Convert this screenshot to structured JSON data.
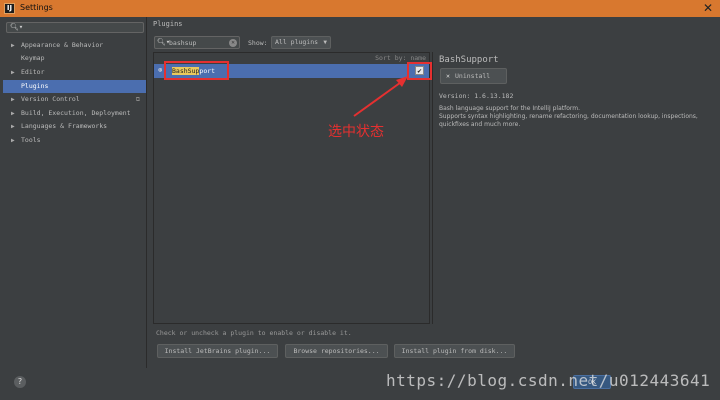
{
  "window": {
    "title": "Settings",
    "close_glyph": "✕"
  },
  "sidebar": {
    "search_placeholder": "",
    "items": [
      {
        "label": "Appearance & Behavior",
        "expandable": true
      },
      {
        "label": "Keymap",
        "expandable": false
      },
      {
        "label": "Editor",
        "expandable": true
      },
      {
        "label": "Plugins",
        "expandable": false,
        "selected": true
      },
      {
        "label": "Version Control",
        "expandable": true
      },
      {
        "label": "Build, Execution, Deployment",
        "expandable": true
      },
      {
        "label": "Languages & Frameworks",
        "expandable": true
      },
      {
        "label": "Tools",
        "expandable": true
      }
    ]
  },
  "plugins": {
    "header": "Plugins",
    "search_value": "bashsup",
    "show_label": "Show:",
    "show_value": "All plugins",
    "sort_by": "Sort by: name",
    "list": [
      {
        "name_highlight": "BashSup",
        "name_rest": "port",
        "checked": true
      }
    ],
    "hint": "Check or uncheck a plugin to enable or disable it.",
    "buttons": {
      "install_jetbrains": "Install JetBrains plugin...",
      "browse": "Browse repositories...",
      "install_disk": "Install plugin from disk..."
    }
  },
  "detail": {
    "title": "BashSupport",
    "uninstall_label": "Uninstall",
    "version": "Version: 1.6.13.182",
    "description_lines": [
      "Bash language support for the IntelliJ platform.",
      "Supports syntax highlighting, rename refactoring, documentation lookup, inspections,",
      "quickfixes and much more."
    ]
  },
  "annotation": {
    "text": "选中状态",
    "color": "#e53030"
  },
  "footer": {
    "help_glyph": "?",
    "ok_label": "OK",
    "watermark": "https://blog.csdn.net/u012443641"
  },
  "colors": {
    "title_bar": "#d8782f",
    "selection": "#4b6eaf",
    "panel_bg": "#3c3f41"
  },
  "icons": [
    "search-icon",
    "clear-icon",
    "plugin-icon",
    "checkbox-icon",
    "uninstall-x-icon",
    "help-icon",
    "close-icon"
  ]
}
